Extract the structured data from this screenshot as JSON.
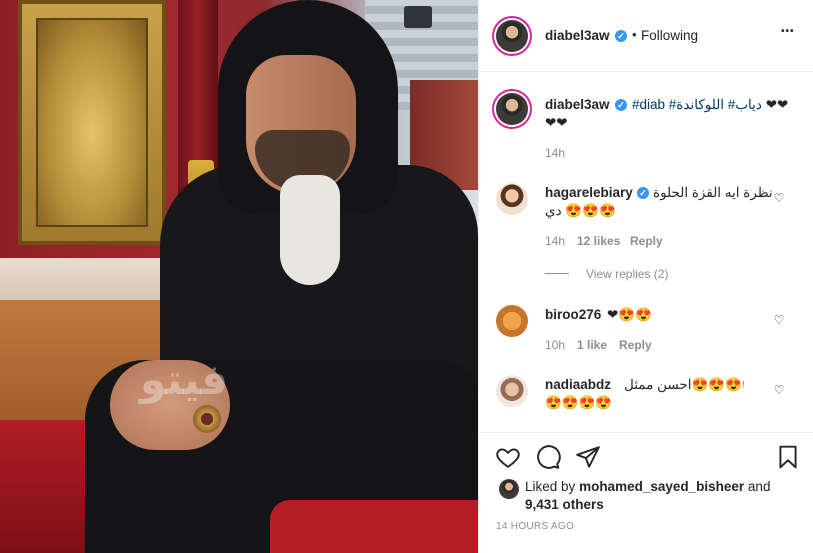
{
  "post": {
    "author": "diabel3aw",
    "follow_status": "Following",
    "separator": "•",
    "more": "•••",
    "photo_watermark": "فيتو"
  },
  "caption": {
    "username": "diabel3aw",
    "text_pre": "❤❤ ",
    "hashtags": "#diab #دياب# اللوكاندة",
    "text_line2": "❤❤",
    "time": "14h"
  },
  "comments": [
    {
      "username": "hagarelebiary",
      "verified": true,
      "text_line1": "نظرة ايه القزة الحلوة",
      "text_line2": "دي 😍😍😍",
      "time": "14h",
      "likes": "12 likes",
      "reply": "Reply",
      "view_replies": "View replies (2)"
    },
    {
      "username": "biroo276",
      "verified": false,
      "text_line1": "❤😍😍",
      "time": "10h",
      "likes": "1 like",
      "reply": "Reply"
    },
    {
      "username": "nadiaabdz",
      "verified": false,
      "text_line1": "احسن ممثل😍😍😍😍😍😍😍😍😍",
      "text_line2": "😍😍😍😍",
      "time": "",
      "likes": "",
      "reply": ""
    }
  ],
  "likes": {
    "prefix": "Liked by",
    "user": "mohamed_sayed_bisheer",
    "and": "and",
    "count": "9,431 others"
  },
  "timestamp": "14 HOURS AGO",
  "colors": {
    "verified": "#3897f0",
    "story_ring": "#d6249f",
    "meta_gray": "#8e8e8e"
  },
  "icons": {
    "like": "heart-icon",
    "comment": "comment-icon",
    "share": "paper-plane-icon",
    "save": "bookmark-icon"
  }
}
